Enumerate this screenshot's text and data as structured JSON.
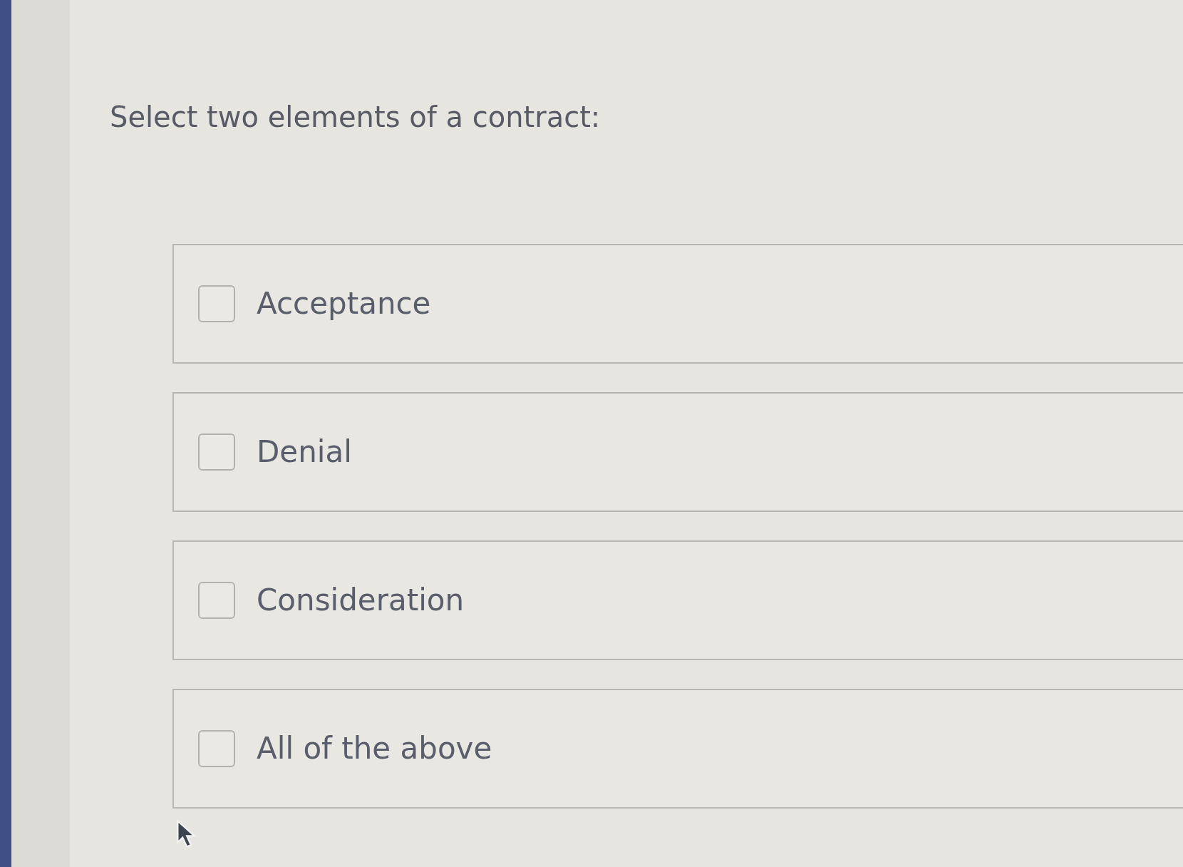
{
  "question": "Select two elements of a contract:",
  "options": [
    {
      "label": "Acceptance",
      "checked": false
    },
    {
      "label": "Denial",
      "checked": false
    },
    {
      "label": "Consideration",
      "checked": false
    },
    {
      "label": "All of the above",
      "checked": false
    }
  ]
}
